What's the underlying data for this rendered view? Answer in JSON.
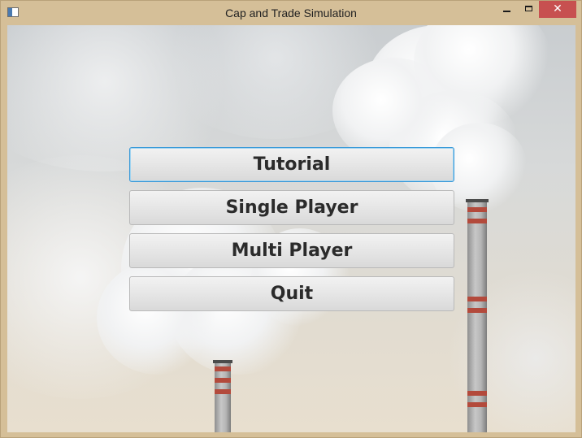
{
  "window": {
    "title": "Cap and Trade Simulation",
    "close_glyph": "✕"
  },
  "icons": {
    "app": "window-app-icon",
    "minimize": "minimize-icon",
    "maximize": "maximize-icon",
    "close": "close-icon"
  },
  "colors": {
    "titlebar": "#d5bf98",
    "close_button": "#c75050",
    "focus_ring": "#3a9ad9"
  },
  "menu": {
    "buttons": [
      {
        "label": "Tutorial",
        "focused": true
      },
      {
        "label": "Single Player",
        "focused": false
      },
      {
        "label": "Multi Player",
        "focused": false
      },
      {
        "label": "Quit",
        "focused": false
      }
    ]
  }
}
